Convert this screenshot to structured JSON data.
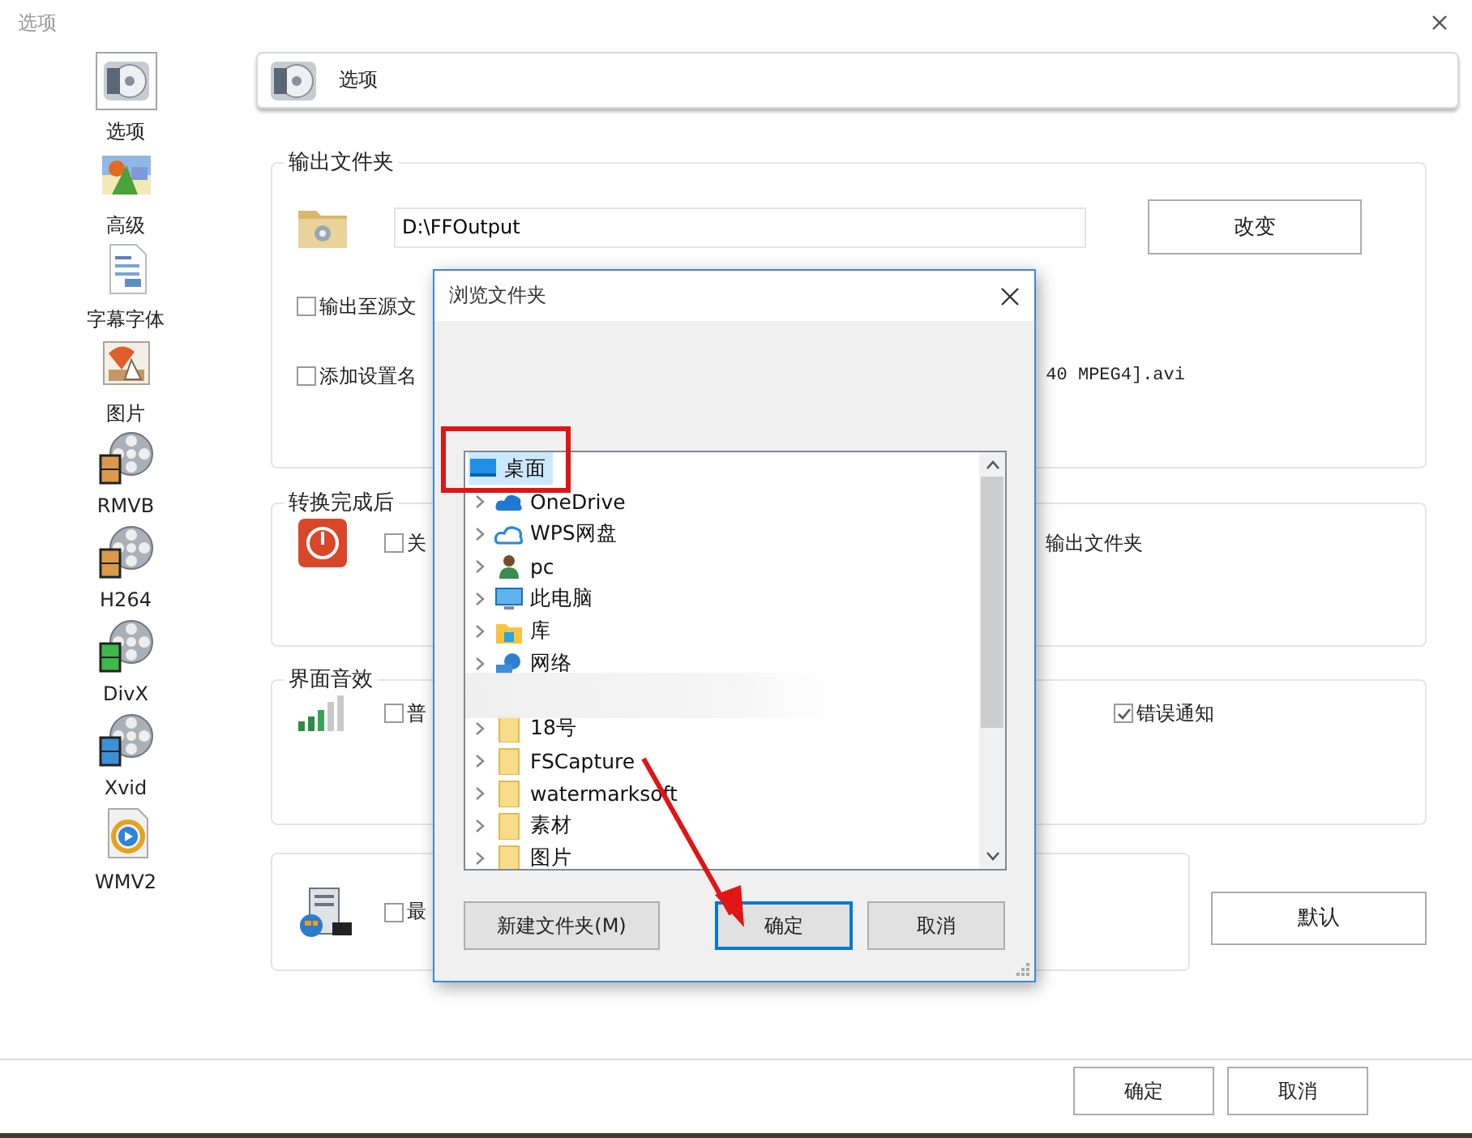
{
  "window": {
    "title": "选项"
  },
  "sidebar": {
    "items": [
      {
        "label": "选项",
        "kind": "options",
        "selected": true
      },
      {
        "label": "高级",
        "kind": "landscape",
        "selected": false
      },
      {
        "label": "字幕字体",
        "kind": "document",
        "selected": false
      },
      {
        "label": "图片",
        "kind": "photo",
        "selected": false
      },
      {
        "label": "RMVB",
        "kind": "film",
        "color": "#d99a4e",
        "selected": false
      },
      {
        "label": "H264",
        "kind": "film",
        "color": "#d99a4e",
        "selected": false
      },
      {
        "label": "DivX",
        "kind": "film",
        "color": "#3fb84a",
        "selected": false
      },
      {
        "label": "Xvid",
        "kind": "film",
        "color": "#3d8fd6",
        "selected": false
      },
      {
        "label": "WMV2",
        "kind": "media",
        "selected": false
      }
    ]
  },
  "header": {
    "title": "选项"
  },
  "output_folder": {
    "legend": "输出文件夹",
    "path": "D:\\FFOutput",
    "change_button": "改变",
    "options": [
      {
        "label": "输出至源文",
        "checked": false
      },
      {
        "label": "添加设置名",
        "checked": false,
        "tail": "40 MPEG4].avi"
      }
    ]
  },
  "after_conversion": {
    "legend": "转换完成后",
    "options": [
      {
        "label": "关",
        "checked": false
      }
    ],
    "tail": "输出文件夹"
  },
  "sound": {
    "legend": "界面音效",
    "options": [
      {
        "label": "普",
        "checked": false
      },
      {
        "label": "错误通知",
        "checked": true
      }
    ]
  },
  "misc": {
    "options": [
      {
        "label": "最",
        "checked": false
      }
    ],
    "default_button": "默认"
  },
  "footer": {
    "buttons": [
      "确定",
      "取消"
    ]
  },
  "dialog": {
    "title": "浏览文件夹",
    "tree": [
      {
        "label": "桌面",
        "kind": "desktop",
        "expandable": false,
        "selected": true
      },
      {
        "label": "OneDrive",
        "kind": "cloud",
        "expandable": true,
        "selected": false
      },
      {
        "label": "WPS网盘",
        "kind": "cloud-outline",
        "expandable": true,
        "selected": false
      },
      {
        "label": "pc",
        "kind": "user",
        "expandable": true,
        "selected": false
      },
      {
        "label": "此电脑",
        "kind": "computer",
        "expandable": true,
        "selected": false
      },
      {
        "label": "库",
        "kind": "library",
        "expandable": true,
        "selected": false
      },
      {
        "label": "网络",
        "kind": "network",
        "expandable": true,
        "selected": false
      },
      {
        "kind": "blurred"
      },
      {
        "label": "18号",
        "kind": "folder",
        "expandable": true,
        "selected": false
      },
      {
        "label": "FSCapture",
        "kind": "folder",
        "expandable": true,
        "selected": false
      },
      {
        "label": "watermarksoft",
        "kind": "folder",
        "expandable": true,
        "selected": false
      },
      {
        "label": "素材",
        "kind": "folder",
        "expandable": true,
        "selected": false
      },
      {
        "label": "图片",
        "kind": "folder",
        "expandable": true,
        "selected": false
      }
    ],
    "buttons": [
      {
        "label": "新建文件夹(M)",
        "focused": false
      },
      {
        "label": "确定",
        "focused": true
      },
      {
        "label": "取消",
        "focused": false
      }
    ]
  }
}
